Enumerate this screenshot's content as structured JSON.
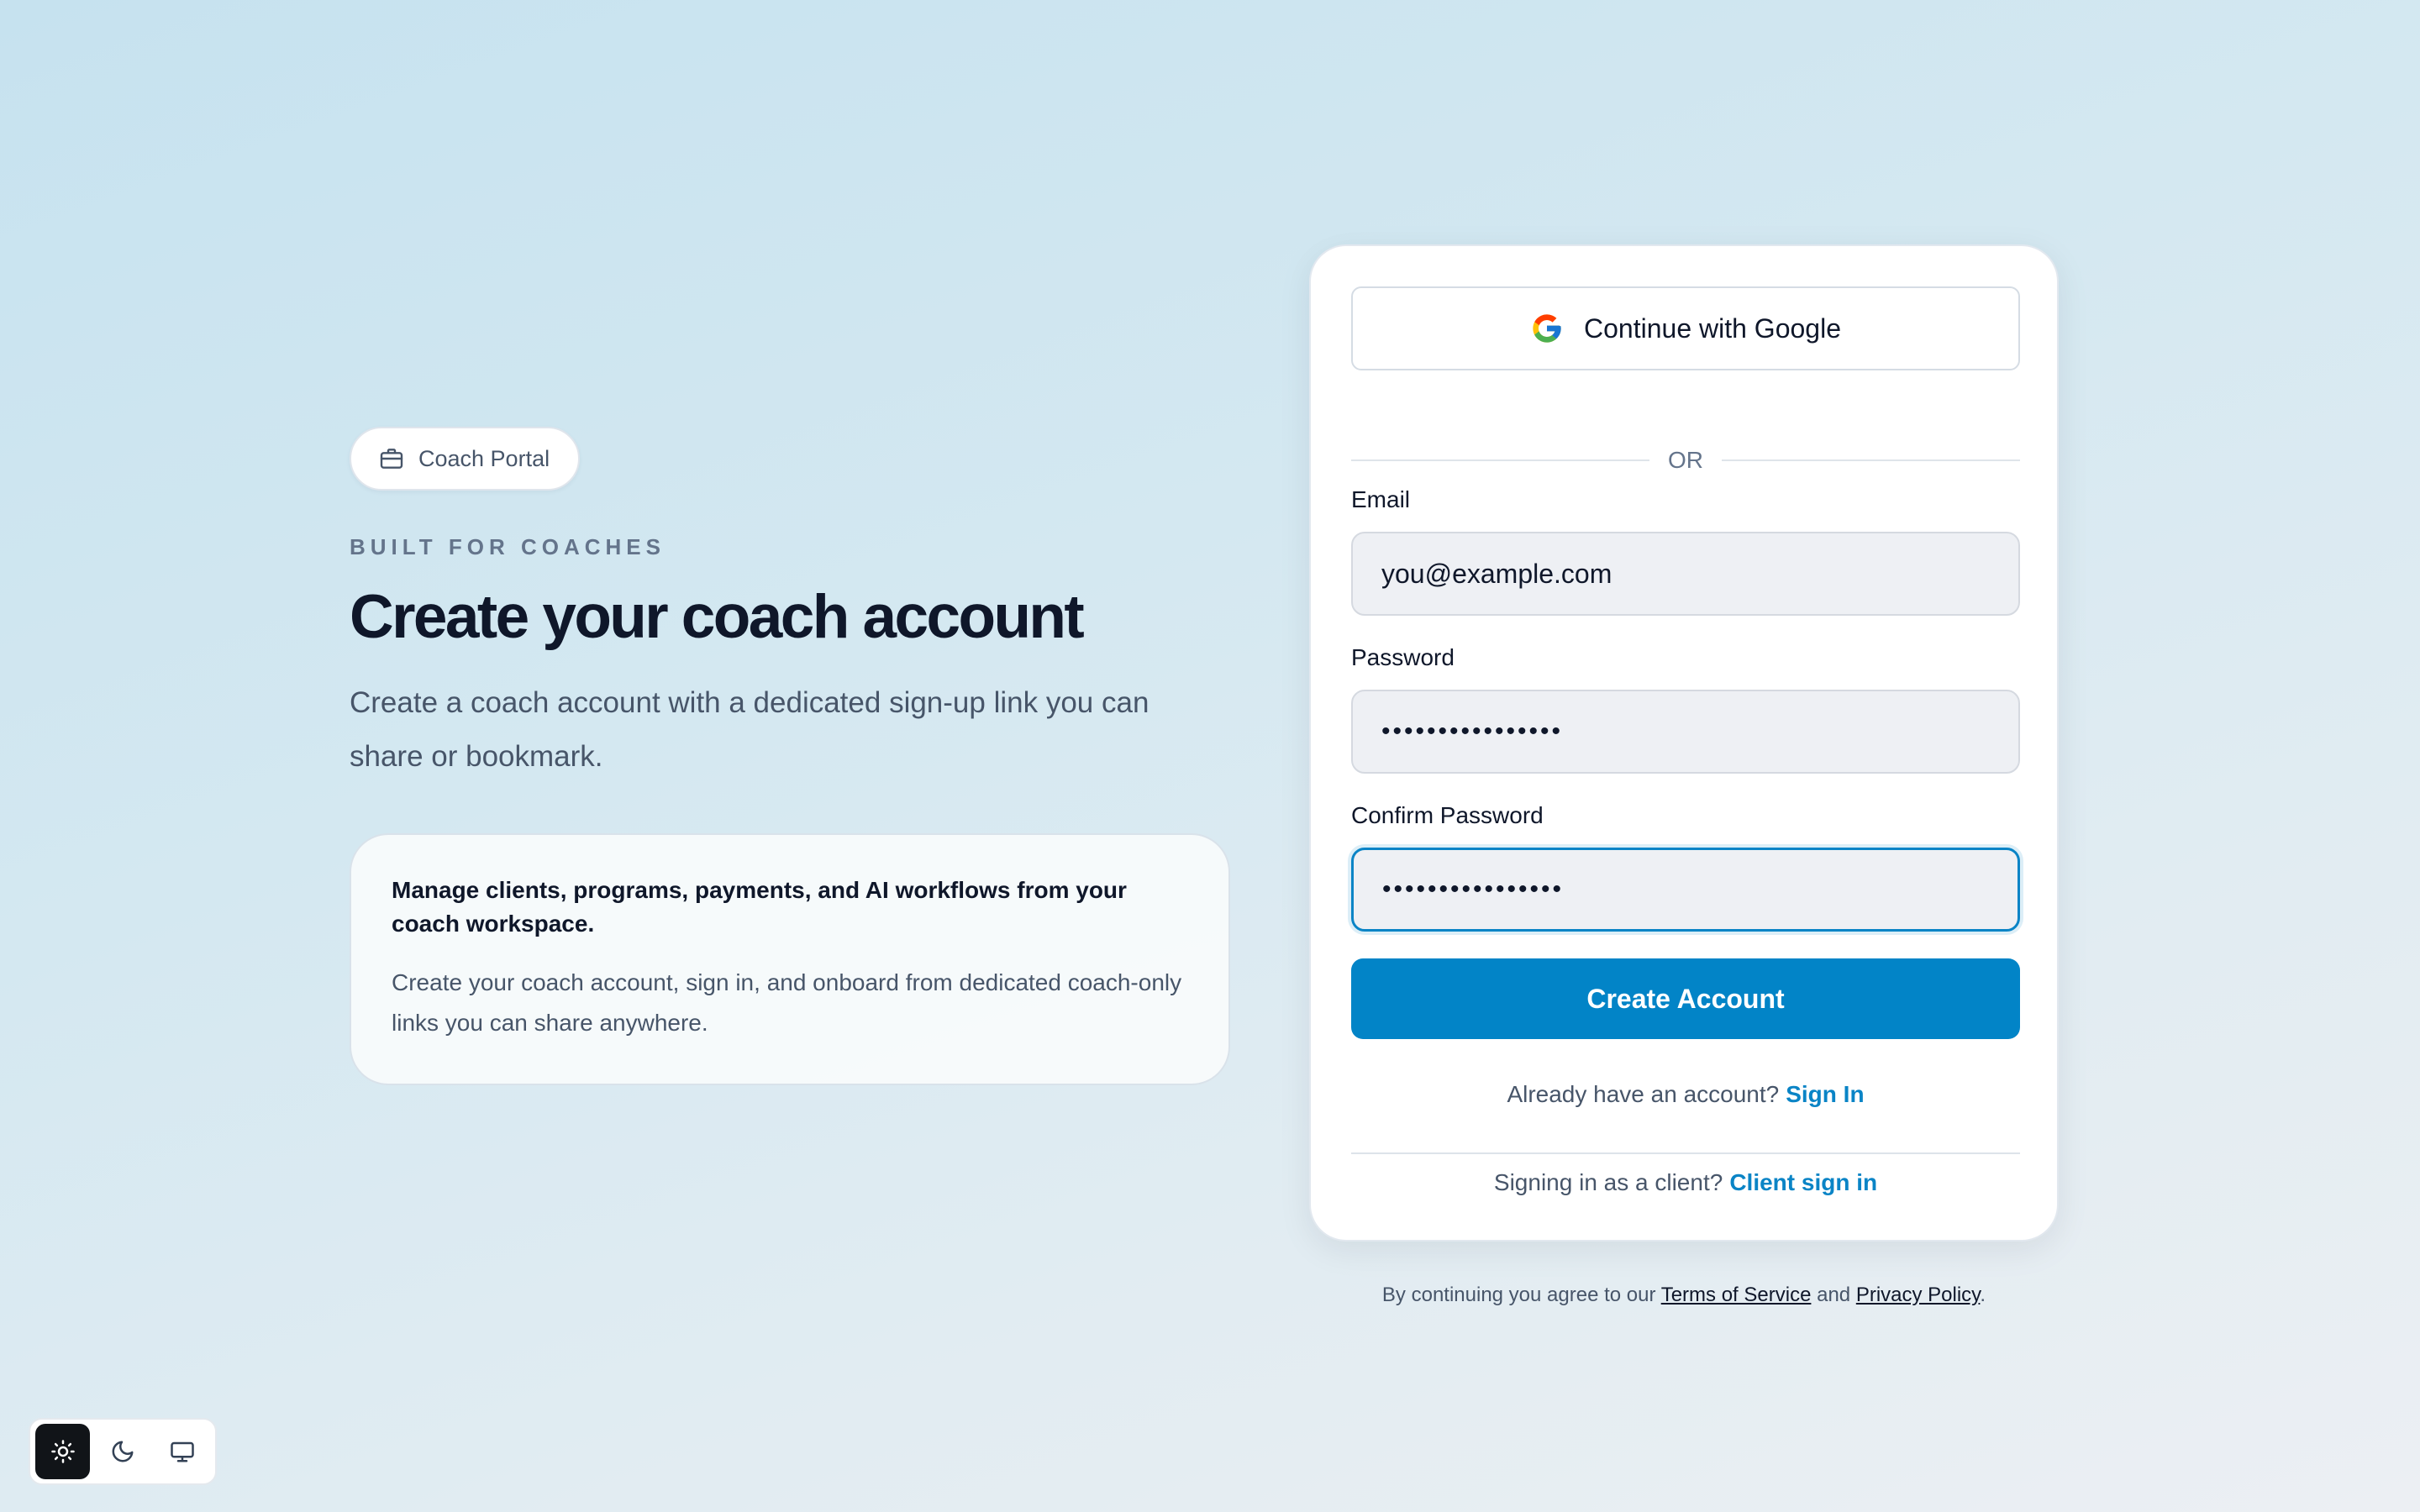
{
  "hero": {
    "badge_label": "Coach Portal",
    "badge_icon": "briefcase-icon",
    "eyebrow": "BUILT FOR COACHES",
    "headline": "Create your coach account",
    "subtext": "Create a coach account with a dedicated sign-up link you can share or bookmark."
  },
  "info_card": {
    "title": "Manage clients, programs, payments, and AI workflows from your coach workspace.",
    "body": "Create your coach account, sign in, and onboard from dedicated coach-only links you can share anywhere."
  },
  "signup": {
    "google_label": "Continue with Google",
    "google_icon": "google-icon",
    "divider_text": "OR",
    "email_label": "Email",
    "email_placeholder": "you@example.com",
    "password_label": "Password",
    "password_value": "••••••••••••••••",
    "confirm_label": "Confirm Password",
    "confirm_value": "••••••••••••••••",
    "submit_label": "Create Account",
    "have_account_text": "Already have an account?",
    "sign_in_link": "Sign In",
    "client_text": "Signing in as a client?",
    "client_link": "Client sign in"
  },
  "legal": {
    "prefix": "By continuing you agree to our",
    "terms_link": "Terms of Service",
    "and_text": "and",
    "privacy_link": "Privacy Policy",
    "suffix": "."
  },
  "theme_toggle": {
    "options": [
      "sun-icon",
      "moon-icon",
      "monitor-icon"
    ],
    "active": "sun-icon"
  },
  "colors": {
    "accent": "#0284c7",
    "heading": "#0f172a",
    "muted": "#475569",
    "link": "#0a84c6"
  }
}
